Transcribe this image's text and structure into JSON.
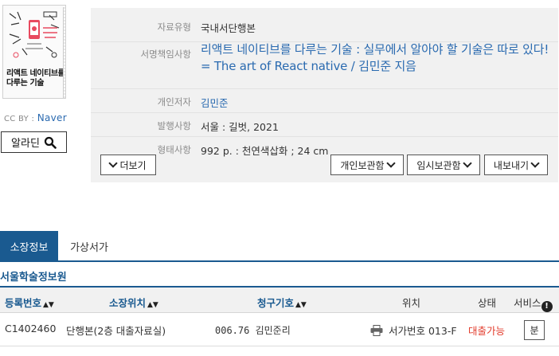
{
  "cover": {
    "image_title_lines": [
      "리액트 네이티브를",
      "다루는 기술"
    ],
    "credit_prefix": "CC BY : ",
    "credit_source": "Naver"
  },
  "report_button": {
    "label": "알라딘",
    "icon": "search-icon"
  },
  "info": {
    "rows": [
      {
        "label": "자료유형",
        "value": "국내서단행본"
      },
      {
        "label": "서명책임사항",
        "value": "리액트 네이티브를 다루는 기술 : 실무에서 알아야 할 기술은 따로 있다! = The art of React native / 김민준 지음"
      },
      {
        "label": "개인저자",
        "value": "김민준"
      },
      {
        "label": "발행사항",
        "value": "서울 : 길벗, 2021"
      },
      {
        "label": "형태사항",
        "value": "992 p. : 천연색삽화 ; 24 cm"
      }
    ],
    "more_button": "더보기",
    "actions": [
      "개인보관함",
      "임시보관함",
      "내보내기"
    ]
  },
  "tabs": [
    {
      "label": "소장정보",
      "active": true
    },
    {
      "label": "가상서가",
      "active": false
    }
  ],
  "library_name": "서울학술정보원",
  "holdings": {
    "headers": {
      "reg_no": "등록번호",
      "location": "소장위치",
      "call_no": "청구기호",
      "position": "위치",
      "status": "상태",
      "service": "서비스"
    },
    "rows": [
      {
        "reg_no": "C1402460",
        "location": "단행본(2층 대출자료실)",
        "call_no": "006.76 김민준리",
        "position": "서가번호 013-F",
        "status": "대출가능",
        "service": "분"
      }
    ]
  },
  "colors": {
    "accent": "#1a5a90",
    "link": "#2a6ab0",
    "status_available": "#e23a2a",
    "panel_bg": "#f1f1f1"
  }
}
